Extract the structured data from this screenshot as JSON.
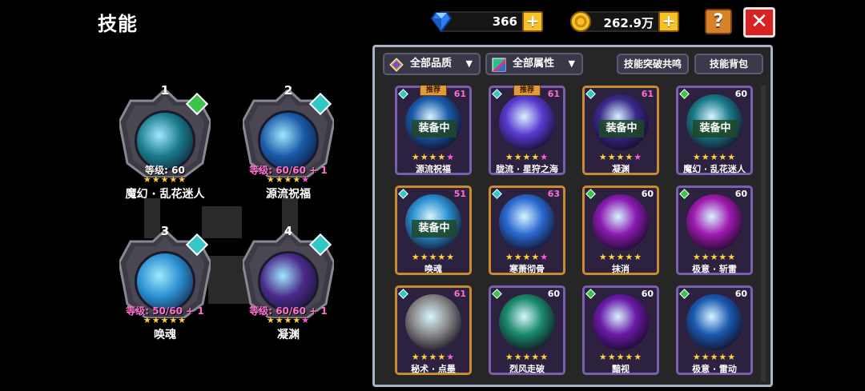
{
  "header": {
    "title": "技能"
  },
  "currency": {
    "gems": "366",
    "gold": "262.9万",
    "plus": "+"
  },
  "buttons": {
    "help": "?",
    "close": "✕"
  },
  "equipped": [
    {
      "slot": "1",
      "level": "等级: 60",
      "stars": "★★★★★",
      "pink_star": "",
      "name": "魔幻 · 乱花迷人",
      "gem_color": "#3cc44a",
      "orb_color": "#1a7a8a",
      "level_pink": false
    },
    {
      "slot": "2",
      "level": "等级: 60/60 + 1",
      "stars": "★★★★",
      "pink_star": "★",
      "name": "源流祝福",
      "gem_color": "#35c6c6",
      "orb_color": "#1a5aa8",
      "level_pink": true
    },
    {
      "slot": "3",
      "level": "等级: 50/60 + 1",
      "stars": "★★★★★",
      "pink_star": "",
      "name": "唤魂",
      "gem_color": "#35c6c6",
      "orb_color": "#2a8fd0",
      "level_pink": true
    },
    {
      "slot": "4",
      "level": "等级: 60/60 + 1",
      "stars": "★★★★",
      "pink_star": "★",
      "name": "凝渊",
      "gem_color": "#35c6c6",
      "orb_color": "#4a2a8a",
      "level_pink": true
    }
  ],
  "toolbar": {
    "quality_filter": "全部品质",
    "attribute_filter": "全部属性",
    "resonance_button": "技能突破共鸣",
    "bag_button": "技能背包"
  },
  "skills": [
    {
      "name": "源流祝福",
      "level": "61",
      "stars": "★★★★",
      "pink": "★",
      "tag": "推荐",
      "equipped": "装备中",
      "gem": "#35c6c6",
      "art": "#1a5aa8",
      "gold": false,
      "lv_pink": true
    },
    {
      "name": "胧流 · 星狩之海",
      "level": "61",
      "stars": "★★★★",
      "pink": "★",
      "tag": "推荐",
      "equipped": "",
      "gem": "#35c6c6",
      "art": "#5a3ad0",
      "gold": false,
      "lv_pink": true
    },
    {
      "name": "凝渊",
      "level": "61",
      "stars": "★★★★",
      "pink": "★",
      "tag": "",
      "equipped": "装备中",
      "gem": "#35c6c6",
      "art": "#3a2a8a",
      "gold": true,
      "lv_pink": true
    },
    {
      "name": "魔幻 · 乱花迷人",
      "level": "60",
      "stars": "★★★★★",
      "pink": "",
      "tag": "",
      "equipped": "装备中",
      "gem": "#3cc44a",
      "art": "#1a7a8a",
      "gold": false,
      "lv_pink": false
    },
    {
      "name": "唤魂",
      "level": "51",
      "stars": "★★★★★",
      "pink": "",
      "tag": "",
      "equipped": "装备中",
      "gem": "#35c6c6",
      "art": "#2a8fd0",
      "gold": true,
      "lv_pink": true
    },
    {
      "name": "寒萧彻骨",
      "level": "63",
      "stars": "★★★★",
      "pink": "★",
      "tag": "",
      "equipped": "",
      "gem": "#35c6c6",
      "art": "#2a6ad0",
      "gold": true,
      "lv_pink": true
    },
    {
      "name": "抹消",
      "level": "60",
      "stars": "★★★★★",
      "pink": "",
      "tag": "",
      "equipped": "",
      "gem": "#3cc44a",
      "art": "#8a1ab0",
      "gold": true,
      "lv_pink": false
    },
    {
      "name": "极意 · 斩雷",
      "level": "60",
      "stars": "★★★★★",
      "pink": "",
      "tag": "",
      "equipped": "",
      "gem": "#3cc44a",
      "art": "#a01ab0",
      "gold": false,
      "lv_pink": false
    },
    {
      "name": "秘术 · 点墨",
      "level": "61",
      "stars": "★★★★",
      "pink": "★",
      "tag": "",
      "equipped": "",
      "gem": "#35c6c6",
      "art": "#8a8a8a",
      "gold": true,
      "lv_pink": true
    },
    {
      "name": "烈风走破",
      "level": "60",
      "stars": "★★★★★",
      "pink": "",
      "tag": "",
      "equipped": "",
      "gem": "#3cc44a",
      "art": "#1a8a6a",
      "gold": false,
      "lv_pink": false
    },
    {
      "name": "黯视",
      "level": "60",
      "stars": "★★★★★",
      "pink": "",
      "tag": "",
      "equipped": "",
      "gem": "#3cc44a",
      "art": "#6a1aa8",
      "gold": false,
      "lv_pink": false
    },
    {
      "name": "极意 · 雷动",
      "level": "60",
      "stars": "★★★★★",
      "pink": "",
      "tag": "",
      "equipped": "",
      "gem": "#3cc44a",
      "art": "#1a5ab0",
      "gold": false,
      "lv_pink": false
    }
  ]
}
